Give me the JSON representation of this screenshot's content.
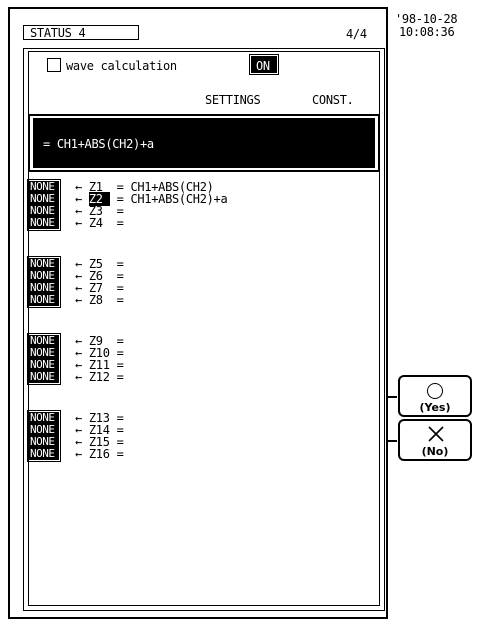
{
  "header": {
    "title": "STATUS 4",
    "page": "4/4",
    "date": "'98-10-28",
    "time": "10:08:36"
  },
  "wave_calc": {
    "label": "wave calculation",
    "state": "ON",
    "checked": false
  },
  "columns": {
    "settings": "SETTINGS",
    "const": "CONST."
  },
  "expression": "= CH1+ABS(CH2)+a",
  "rows": [
    {
      "tag": "NONE",
      "z": "Z1 ",
      "formula": "= CH1+ABS(CH2)",
      "selected": false
    },
    {
      "tag": "NONE",
      "z": "Z2 ",
      "formula": "= CH1+ABS(CH2)+a",
      "selected": true
    },
    {
      "tag": "NONE",
      "z": "Z3 ",
      "formula": "=",
      "selected": false
    },
    {
      "tag": "NONE",
      "z": "Z4 ",
      "formula": "=",
      "selected": false
    },
    {
      "tag": "NONE",
      "z": "Z5 ",
      "formula": "=",
      "selected": false
    },
    {
      "tag": "NONE",
      "z": "Z6 ",
      "formula": "=",
      "selected": false
    },
    {
      "tag": "NONE",
      "z": "Z7 ",
      "formula": "=",
      "selected": false
    },
    {
      "tag": "NONE",
      "z": "Z8 ",
      "formula": "=",
      "selected": false
    },
    {
      "tag": "NONE",
      "z": "Z9 ",
      "formula": "=",
      "selected": false
    },
    {
      "tag": "NONE",
      "z": "Z10",
      "formula": "=",
      "selected": false
    },
    {
      "tag": "NONE",
      "z": "Z11",
      "formula": "=",
      "selected": false
    },
    {
      "tag": "NONE",
      "z": "Z12",
      "formula": "=",
      "selected": false
    },
    {
      "tag": "NONE",
      "z": "Z13",
      "formula": "=",
      "selected": false
    },
    {
      "tag": "NONE",
      "z": "Z14",
      "formula": "=",
      "selected": false
    },
    {
      "tag": "NONE",
      "z": "Z15",
      "formula": "=",
      "selected": false
    },
    {
      "tag": "NONE",
      "z": "Z16",
      "formula": "=",
      "selected": false
    }
  ],
  "arrow": "←",
  "buttons": {
    "yes_label": "(Yes)",
    "no_label": "(No)"
  }
}
